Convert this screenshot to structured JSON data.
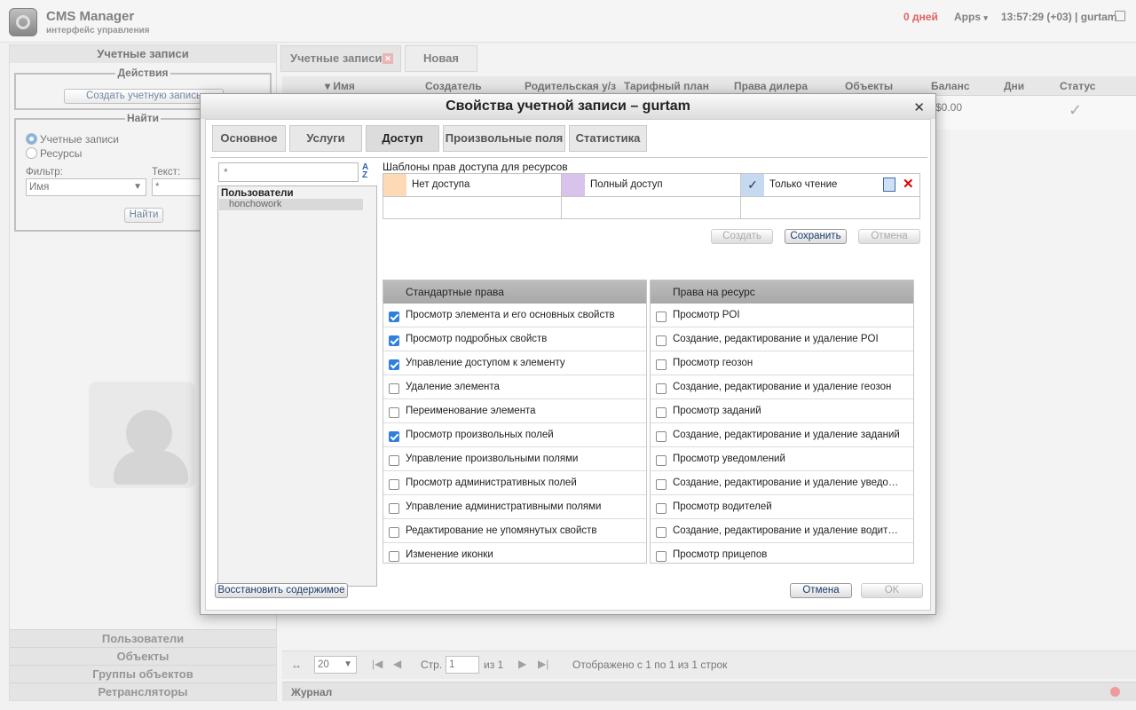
{
  "header": {
    "app_name": "CMS Manager",
    "app_subtitle": "интерфейс управления",
    "days": "0 дней",
    "apps": "Apps",
    "clock_user": "13:57:29 (+03)  |  gurtam"
  },
  "left": {
    "title": "Учетные записи",
    "actions_legend": "Действия",
    "create_btn": "Создать учетную запись",
    "find_legend": "Найти",
    "radio_accounts": "Учетные записи",
    "radio_resources": "Ресурсы",
    "filter_label": "Фильтр:",
    "text_label": "Текст:",
    "filter_value": "Имя",
    "text_value": "*",
    "find_btn": "Найти",
    "accordion": [
      "Пользователи",
      "Объекты",
      "Группы объектов",
      "Ретрансляторы"
    ]
  },
  "main": {
    "tabs": [
      "Учетные записи",
      "Новая"
    ],
    "columns": [
      "Имя",
      "Создатель",
      "Родительская у/з",
      "Тарифный план",
      "Права дилера",
      "Объекты",
      "Баланс",
      "Дни",
      "Статус"
    ],
    "row_balance": "$0.00",
    "pager": {
      "page_size": "20",
      "page_label": "Стр.",
      "page_value": "1",
      "of": "из 1",
      "shown": "Отображено с 1 по 1 из 1 строк"
    },
    "journal": "Журнал"
  },
  "dialog": {
    "title": "Свойства учетной записи – gurtam",
    "tabs": [
      "Основное",
      "Услуги",
      "Доступ",
      "Произвольные поля",
      "Статистика"
    ],
    "search_value": "*",
    "users_group": "Пользователи",
    "user_item": "honchowork",
    "templates_title": "Шаблоны прав доступа для ресурсов",
    "templates": [
      {
        "label": "Нет доступа",
        "color": "#fdd9b5"
      },
      {
        "label": "Полный доступ",
        "color": "#d9c2ec"
      },
      {
        "label": "Только чтение",
        "color": "#c5d9f0"
      }
    ],
    "btn_create": "Создать",
    "btn_save": "Сохранить",
    "btn_cancel_tpl": "Отмена",
    "std_header": "Стандартные права",
    "std_rights": [
      {
        "label": "Просмотр элемента и его основных свойств",
        "checked": true
      },
      {
        "label": "Просмотр подробных свойств",
        "checked": true
      },
      {
        "label": "Управление доступом к элементу",
        "checked": true
      },
      {
        "label": "Удаление элемента",
        "checked": false
      },
      {
        "label": "Переименование элемента",
        "checked": false
      },
      {
        "label": "Просмотр произвольных полей",
        "checked": true
      },
      {
        "label": "Управление произвольными полями",
        "checked": false
      },
      {
        "label": "Просмотр административных полей",
        "checked": false
      },
      {
        "label": "Управление административными полями",
        "checked": false
      },
      {
        "label": "Редактирование не упомянутых свойств",
        "checked": false
      },
      {
        "label": "Изменение иконки",
        "checked": false
      }
    ],
    "res_header": "Права на ресурс",
    "res_rights": [
      {
        "label": "Просмотр POI",
        "checked": false
      },
      {
        "label": "Создание, редактирование и удаление POI",
        "checked": false
      },
      {
        "label": "Просмотр геозон",
        "checked": false
      },
      {
        "label": "Создание, редактирование и удаление геозон",
        "checked": false
      },
      {
        "label": "Просмотр заданий",
        "checked": false
      },
      {
        "label": "Создание, редактирование и удаление заданий",
        "checked": false
      },
      {
        "label": "Просмотр уведомлений",
        "checked": false
      },
      {
        "label": "Создание, редактирование и удаление уведо…",
        "checked": false
      },
      {
        "label": "Просмотр водителей",
        "checked": false
      },
      {
        "label": "Создание, редактирование и удаление водит…",
        "checked": false
      },
      {
        "label": "Просмотр прицепов",
        "checked": false
      }
    ],
    "btn_restore": "Восстановить содержимое",
    "btn_cancel": "Отмена",
    "btn_ok": "OK"
  }
}
